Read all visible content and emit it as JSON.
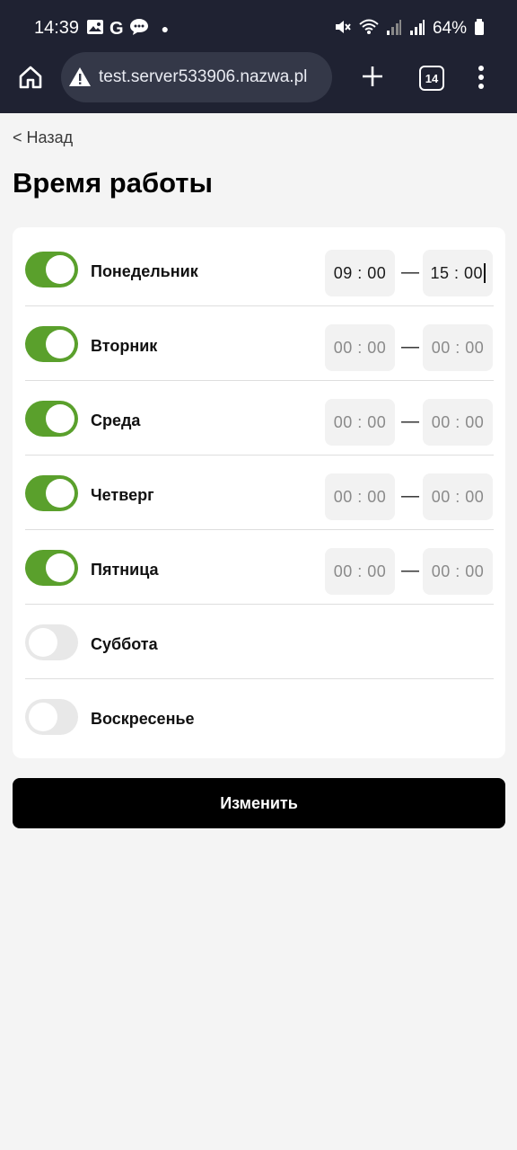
{
  "status_bar": {
    "time": "14:39",
    "battery": "64%",
    "icons_left": [
      "image-icon",
      "google-icon",
      "message-icon",
      "dot-icon"
    ],
    "icons_right": [
      "mute-icon",
      "wifi-icon",
      "signal-icon",
      "signal-icon",
      "battery-icon"
    ]
  },
  "browser": {
    "url": "test.server533906.nazwa.pl",
    "tab_count": "14"
  },
  "page": {
    "back_label": "< Назад",
    "title": "Время работы",
    "submit_label": "Изменить"
  },
  "days": [
    {
      "label": "Понедельник",
      "enabled": true,
      "from": "09 : 00",
      "to": "15 : 00",
      "filled": true
    },
    {
      "label": "Вторник",
      "enabled": true,
      "from": "00 : 00",
      "to": "00 : 00",
      "filled": false
    },
    {
      "label": "Среда",
      "enabled": true,
      "from": "00 : 00",
      "to": "00 : 00",
      "filled": false
    },
    {
      "label": "Четверг",
      "enabled": true,
      "from": "00 : 00",
      "to": "00 : 00",
      "filled": false
    },
    {
      "label": "Пятница",
      "enabled": true,
      "from": "00 : 00",
      "to": "00 : 00",
      "filled": false
    },
    {
      "label": "Суббота",
      "enabled": false
    },
    {
      "label": "Воскресенье",
      "enabled": false
    }
  ],
  "range_separator": "—",
  "colors": {
    "toggle_on": "#5aa02c",
    "toggle_off": "#e8e8e8",
    "chrome_bg": "#1f2232",
    "button_bg": "#000000"
  }
}
